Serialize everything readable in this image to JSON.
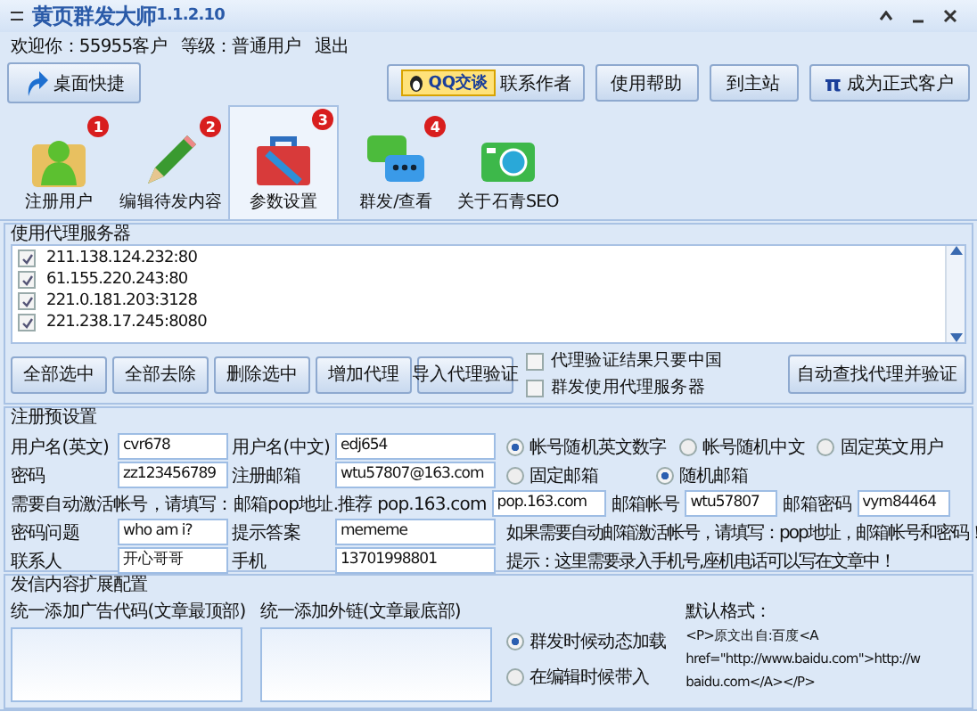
{
  "window": {
    "title": "黄页群发大师",
    "version": "1.1.2.10"
  },
  "user_bar": [
    "欢迎你：55955客户",
    "等级：普通用户",
    "退出"
  ],
  "toolbar": {
    "shortcut": "桌面快捷",
    "qq_badge": "QQ交谈",
    "qq_label": "联系作者",
    "buttons": [
      {
        "label": "使用帮助"
      },
      {
        "label": "到主站"
      },
      {
        "label": "成为正式客户",
        "prefix": "π"
      }
    ]
  },
  "tabs": [
    {
      "label": "注册用户",
      "badge": "1",
      "selected": false
    },
    {
      "label": "编辑待发内容",
      "badge": "2",
      "selected": false
    },
    {
      "label": "参数设置",
      "badge": "3",
      "selected": true
    },
    {
      "label": "群发/查看",
      "badge": "4",
      "selected": false
    },
    {
      "label": "关于石青SEO",
      "selected": false
    }
  ],
  "proxy": {
    "title": "使用代理服务器",
    "items": [
      {
        "address": "211.138.124.232:80",
        "checked": true
      },
      {
        "address": "61.155.220.243:80",
        "checked": true
      },
      {
        "address": "221.0.181.203:3128",
        "checked": true
      },
      {
        "address": "221.238.17.245:8080",
        "checked": true
      }
    ],
    "buttons": [
      "全部选中",
      "全部去除",
      "删除选中",
      "增加代理",
      "导入代理验证"
    ],
    "options": [
      {
        "label": "代理验证结果只要中国",
        "checked": false
      },
      {
        "label": "群发使用代理服务器",
        "checked": false
      }
    ],
    "find_button": "自动查找代理并验证"
  },
  "registration": {
    "title": "注册预设置",
    "username_en": {
      "label": "用户名(英文)",
      "value": "cvr678"
    },
    "username_cn": {
      "label": "用户名(中文)",
      "value": "edj654"
    },
    "account_modes": [
      {
        "label": "帐号随机英文数字",
        "selected": true
      },
      {
        "label": "帐号随机中文",
        "selected": false
      },
      {
        "label": "固定英文用户",
        "selected": false
      }
    ],
    "password": {
      "label": "密码",
      "value": "zz123456789"
    },
    "email": {
      "label": "注册邮箱",
      "value": "wtu57807@163.com"
    },
    "email_modes": [
      {
        "label": "固定邮箱",
        "selected": false
      },
      {
        "label": "随机邮箱",
        "selected": true
      }
    ],
    "pop": {
      "label": "需要自动激活帐号，请填写：邮箱pop地址.推荐 pop.163.com",
      "value": "pop.163.com"
    },
    "mail_account": {
      "label": "邮箱帐号",
      "value": "wtu57807"
    },
    "mail_password": {
      "label": "邮箱密码",
      "value": "vym84464"
    },
    "question": {
      "label": "密码问题",
      "value": "who am i?"
    },
    "answer": {
      "label": "提示答案",
      "value": "mememe"
    },
    "activation_note": "如果需要自动邮箱激活帐号，请填写：pop地址，邮箱帐号和密码！",
    "contact": {
      "label": "联系人",
      "value": "开心哥哥"
    },
    "mobile": {
      "label": "手机",
      "value": "13701998801"
    },
    "mobile_note": "提示：这里需要录入手机号,座机电话可以写在文章中！"
  },
  "content": {
    "title": "发信内容扩展配置",
    "ad_label": "统一添加广告代码(文章最顶部)",
    "link_label": "统一添加外链(文章最底部)",
    "modes": [
      {
        "label": "群发时候动态加载",
        "selected": true
      },
      {
        "label": "在编辑时候带入",
        "selected": false
      }
    ],
    "format_title": "默认格式：",
    "format_lines": [
      "<P>原文出自:百度<A",
      "href=\"http://www.baidu.com\">http://w",
      "baidu.com</A></P>"
    ]
  }
}
